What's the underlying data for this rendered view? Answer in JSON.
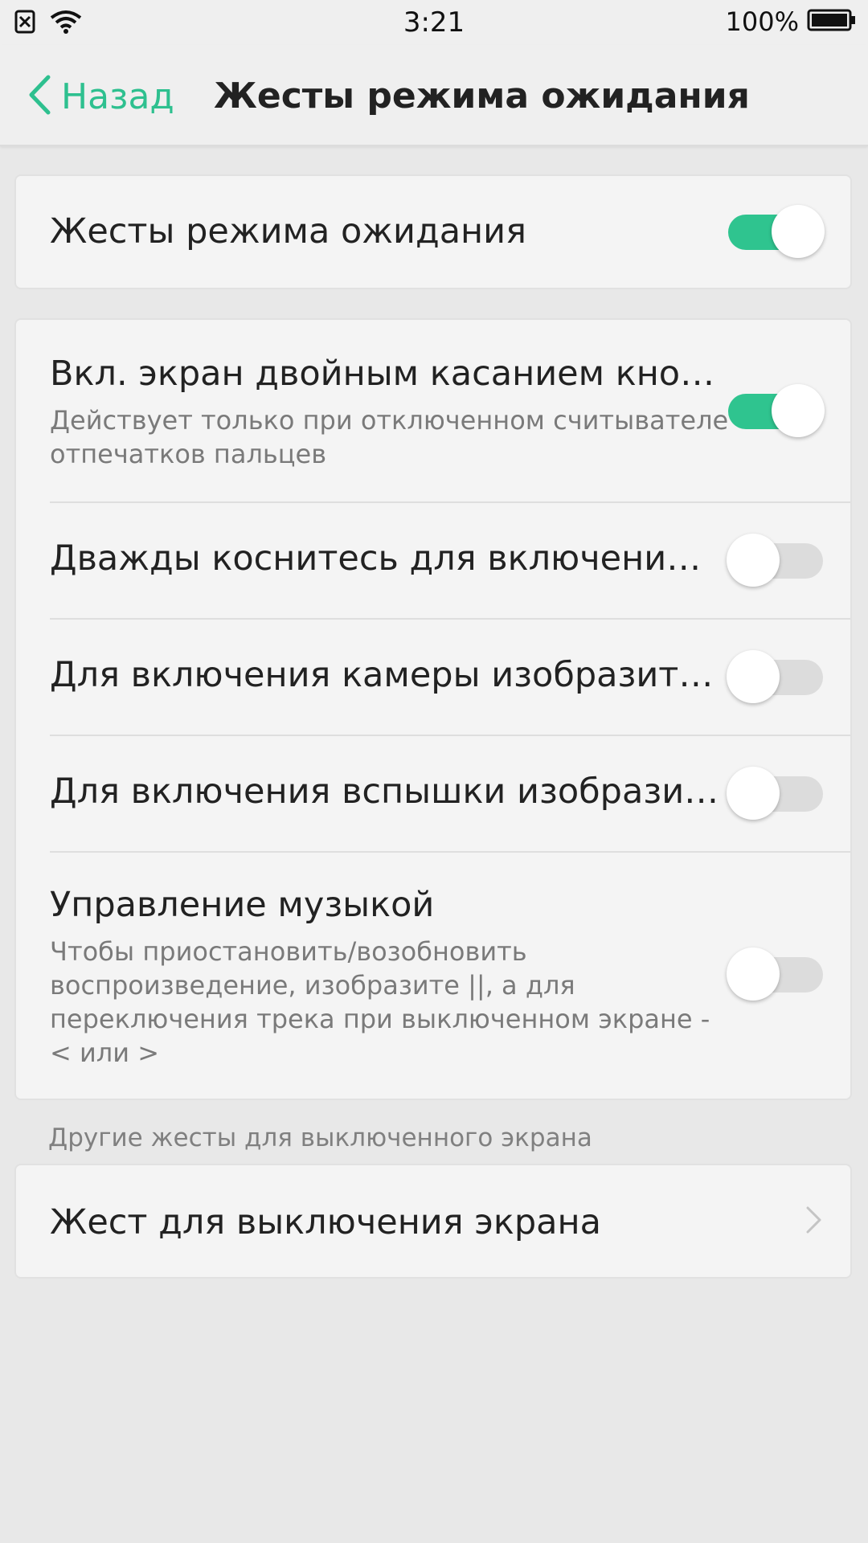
{
  "status_bar": {
    "time": "3:21",
    "battery_percent": "100%",
    "icons": [
      "sim-blocked-icon",
      "wifi-icon",
      "battery-icon"
    ]
  },
  "header": {
    "back_label": "Назад",
    "title": "Жесты режима ожидания",
    "accent_color": "#2ec08f"
  },
  "main_toggle": {
    "label": "Жесты режима ожидания",
    "enabled": true
  },
  "gestures": [
    {
      "title": "Вкл. экран двойным касанием кнопк...",
      "subtitle": "Действует только при отключенном считывателе отпечатков пальцев",
      "enabled": true
    },
    {
      "title": "Дважды коснитесь для включения э...",
      "enabled": false
    },
    {
      "title": "Для включения камеры изобразите  ...",
      "enabled": false
    },
    {
      "title": "Для включения вспышки изобразит...",
      "enabled": false
    },
    {
      "title": "Управление музыкой",
      "subtitle": "Чтобы приостановить/возобновить воспроизведение, изобразите ||, а для переключения трека при выключенном экране - < или >",
      "enabled": false
    }
  ],
  "other_section": {
    "label": "Другие жесты для выключенного экрана",
    "item_label": "Жест для выключения экрана"
  }
}
